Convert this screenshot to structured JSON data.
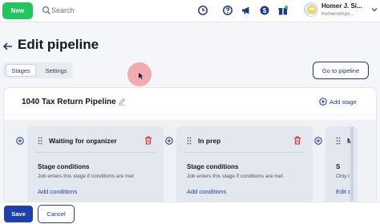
{
  "topbar": {
    "new_label": "New",
    "search_placeholder": "Search",
    "user_name": "Homer J. Si...",
    "user_sub": "homersimps...",
    "icons": [
      "clock-icon",
      "help-icon",
      "megaphone-icon",
      "dollar-icon",
      "gift-icon"
    ]
  },
  "header": {
    "title": "Edit pipeline",
    "tabs": [
      {
        "label": "Stages",
        "active": true
      },
      {
        "label": "Settings",
        "active": false
      }
    ],
    "goto_label": "Go to pipeline"
  },
  "pipeline": {
    "name": "1040 Tax Return Pipeline",
    "add_stage_label": "Add stage"
  },
  "stages": [
    {
      "name": "Waiting for organizer",
      "conditions_title": "Stage conditions",
      "conditions_desc": "Job enters this stage if conditions are met",
      "link_label": "Add conditions"
    },
    {
      "name": "In prep",
      "conditions_title": "Stage conditions",
      "conditions_desc": "Job enters this stage if conditions are met",
      "link_label": "Add conditions"
    },
    {
      "name": "M",
      "conditions_title": "S",
      "conditions_desc": "Only t",
      "link_label": "Edit c"
    }
  ],
  "footer": {
    "save_label": "Save",
    "cancel_label": "Cancel"
  },
  "colors": {
    "accent": "#1e40af",
    "new_button": "#22c55e",
    "danger": "#dc2626"
  }
}
